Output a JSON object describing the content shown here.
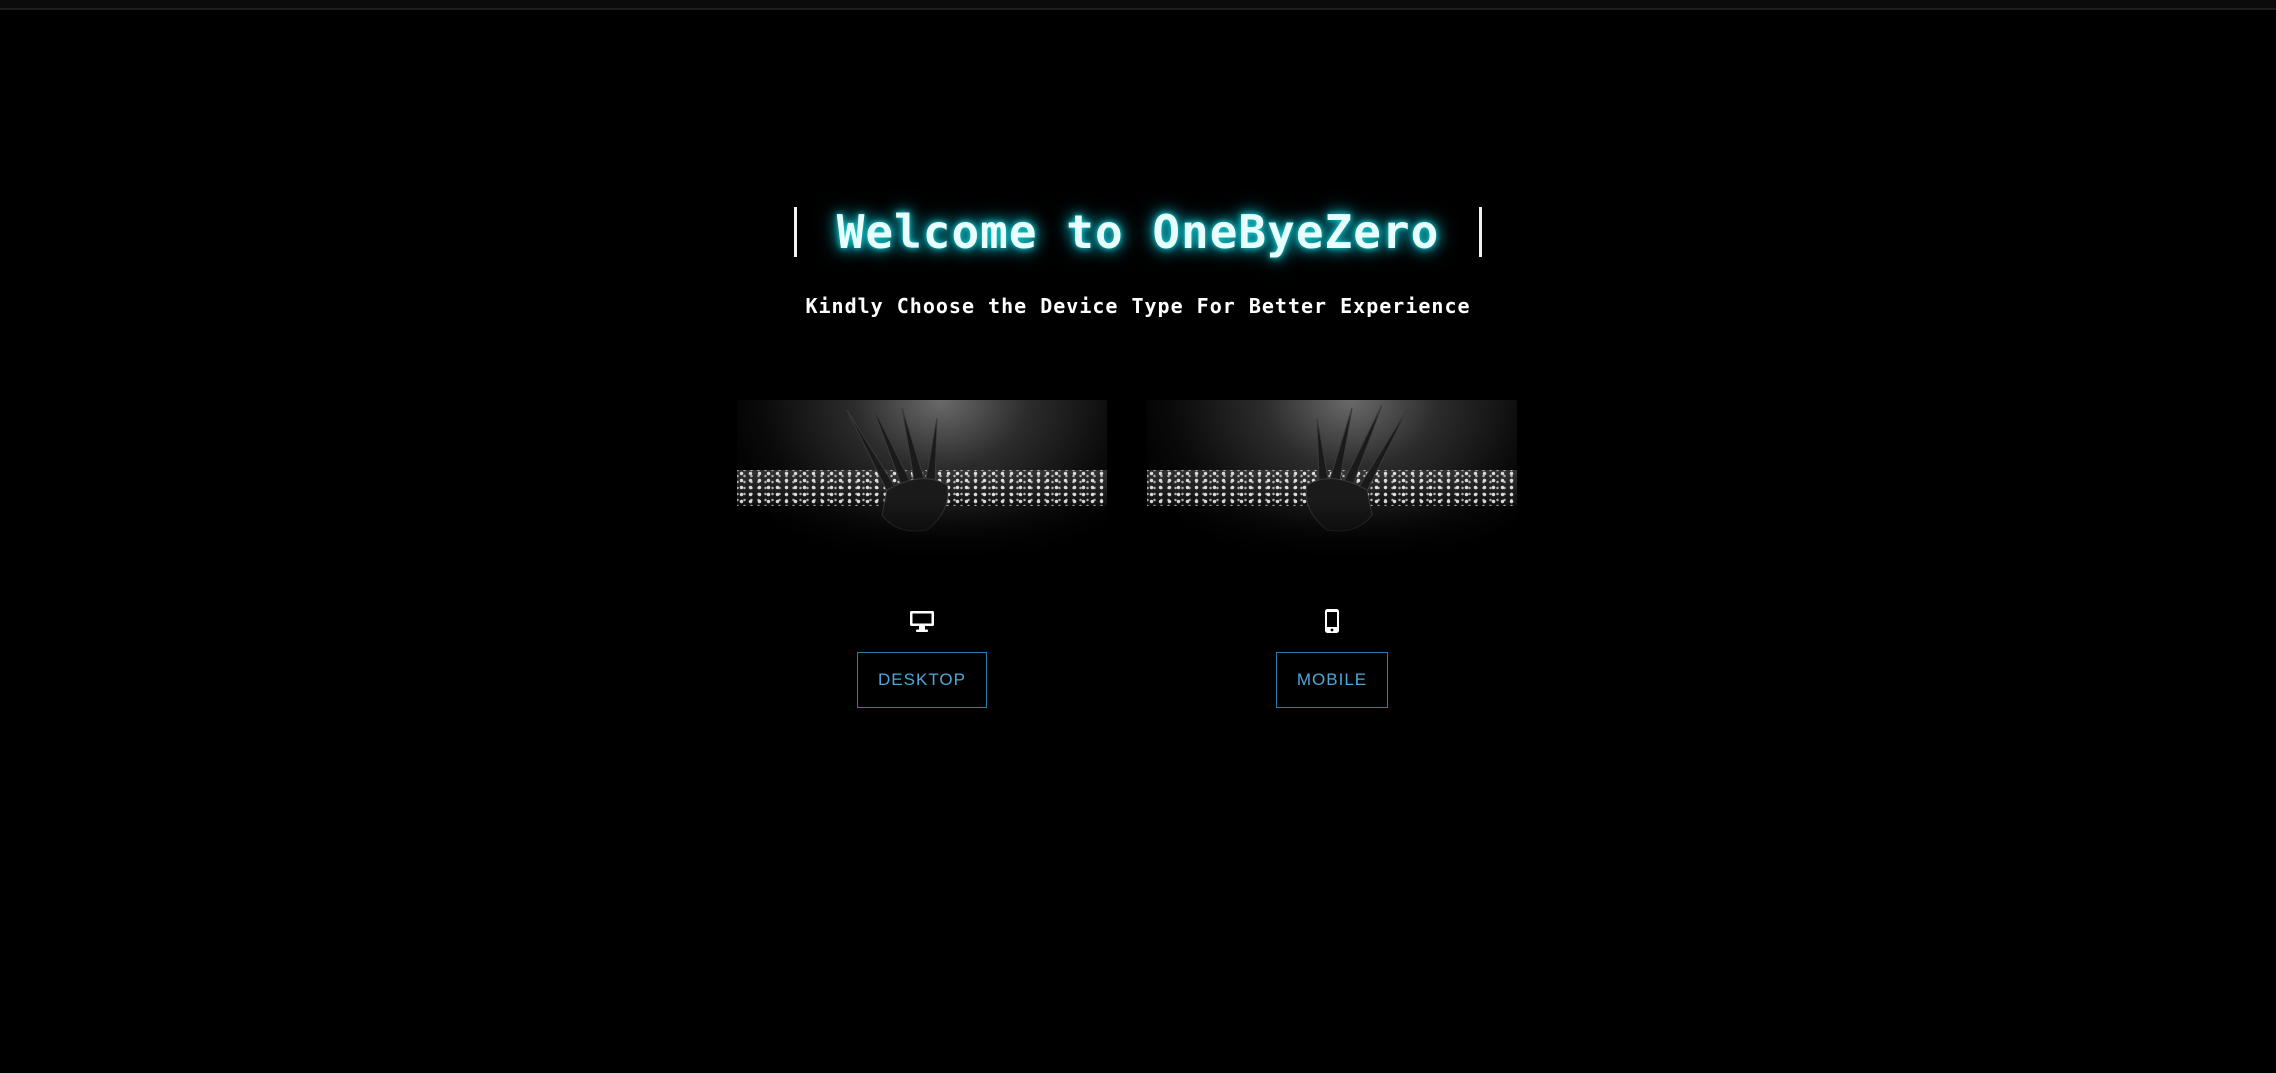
{
  "header": {
    "title": "Welcome to OneByeZero",
    "subtitle": "Kindly Choose the Device Type For Better Experience"
  },
  "options": {
    "desktop": {
      "label": "DESKTOP",
      "icon": "desktop-icon"
    },
    "mobile": {
      "label": "MOBILE",
      "icon": "mobile-phone-icon"
    }
  },
  "colors": {
    "background": "#000000",
    "title_glow": "#19d4d4",
    "button_border": "#2a7fb0",
    "button_text": "#4ea7da"
  }
}
